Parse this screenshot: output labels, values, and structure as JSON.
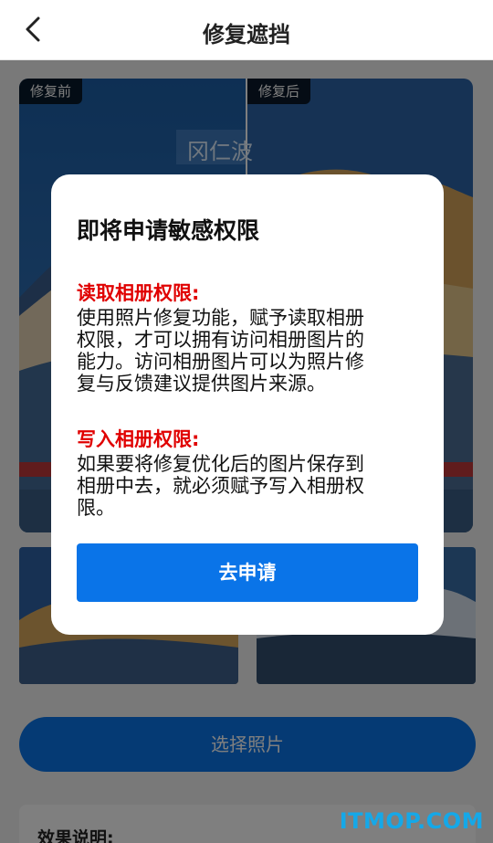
{
  "header": {
    "title": "修复遮挡",
    "back_icon": "chevron-left-icon"
  },
  "compare": {
    "before_label": "修复前",
    "after_label": "修复后",
    "watermark_text": "冈仁波"
  },
  "select_button_label": "选择照片",
  "info": {
    "title": "效果说明:"
  },
  "brand_text": "ITMOP.COM",
  "dialog": {
    "title": "即将申请敏感权限",
    "read_title": "读取相册权限:",
    "read_body_lines": [
      "使用照片修复功能，赋予读取相册",
      "权限，才可以拥有访问相册图片的",
      "能力。访问相册图片可以为照片修",
      "复与反馈建议提供图片来源。"
    ],
    "write_title": "写入相册权限:",
    "write_body_lines": [
      "如果要将修复优化后的图片保存到",
      "相册中去，就必须赋予写入相册权",
      "限。"
    ],
    "apply_button_label": "去申请"
  },
  "colors": {
    "accent": "#0a74e8",
    "warning": "#e00000",
    "overlay": "rgba(0,0,0,0.5)"
  }
}
